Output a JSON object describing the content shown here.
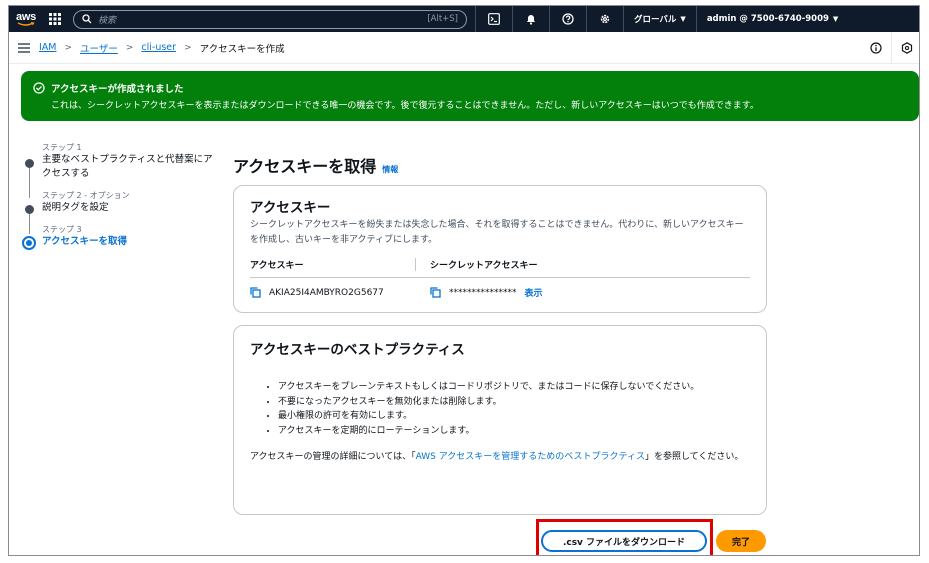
{
  "topnav": {
    "logo_text": "aws",
    "search_placeholder": "検索",
    "search_shortcut": "[Alt+S]",
    "region_label": "グローバル",
    "account_label": "admin @ 7500-6740-9009",
    "icons": [
      "cloudshell-icon",
      "bell-icon",
      "help-icon",
      "gear-icon"
    ]
  },
  "breadcrumb": {
    "items": [
      "IAM",
      "ユーザー",
      "cli-user"
    ],
    "current": "アクセスキーを作成"
  },
  "flash": {
    "title": "アクセスキーが作成されました",
    "body": "これは、シークレットアクセスキーを表示またはダウンロードできる唯一の機会です。後で復元することはできません。ただし、新しいアクセスキーはいつでも作成できます。"
  },
  "steps": [
    {
      "num": "ステップ 1",
      "label": "主要なベストプラクティスと代替案にアクセスする"
    },
    {
      "num": "ステップ 2 - オプション",
      "label": "説明タグを設定"
    },
    {
      "num": "ステップ 3",
      "label": "アクセスキーを取得"
    }
  ],
  "main": {
    "title": "アクセスキーを取得",
    "info": "情報",
    "access_key_card": {
      "title": "アクセスキー",
      "description": "シークレットアクセスキーを紛失または失念した場合、それを取得することはできません。代わりに、新しいアクセスキーを作成し、古いキーを非アクティブにします。",
      "col1_header": "アクセスキー",
      "col2_header": "シークレットアクセスキー",
      "access_key_value": "AKIA25I4AMBYRO2G5677",
      "secret_masked": "***************",
      "show_label": "表示"
    },
    "best_practices_card": {
      "title": "アクセスキーのベストプラクティス",
      "items": [
        "アクセスキーをプレーンテキストもしくはコードリポジトリで、またはコードに保存しないでください。",
        "不要になったアクセスキーを無効化または削除します。",
        "最小権限の許可を有効にします。",
        "アクセスキーを定期的にローテーションします。"
      ],
      "note_prefix": "アクセスキーの管理の詳細については、「",
      "note_link": "AWS アクセスキーを管理するためのベストプラクティス",
      "note_suffix": "」を参照してください。"
    }
  },
  "footer": {
    "download_label": ".csv ファイルをダウンロード",
    "done_label": "完了"
  },
  "colors": {
    "nav_bg": "#0f1b2a",
    "success": "#037f0c",
    "link": "#0972d3",
    "primary": "#ff9900",
    "highlight": "#e00000"
  }
}
